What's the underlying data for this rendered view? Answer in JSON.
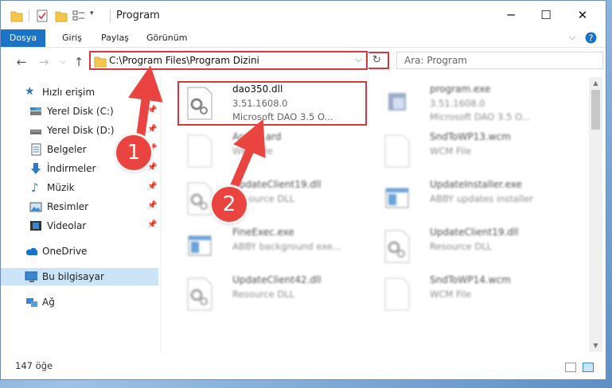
{
  "window": {
    "title": "Program",
    "controls": {
      "minimize": "─",
      "maximize": "☐",
      "close": "✕"
    }
  },
  "ribbon": {
    "tabs": [
      "Dosya",
      "Giriş",
      "Paylaş",
      "Görünüm"
    ],
    "accent": "#1a73c7"
  },
  "nav": {
    "address": "C:\\Program Files\\Program Dizini",
    "search_placeholder": "Ara: Program",
    "back": "←",
    "forward": "→",
    "up": "↑",
    "dropdown": "⌵",
    "refresh": "↻"
  },
  "sidebar": {
    "quick_access": "Hızlı erişim",
    "items": [
      {
        "label": "Yerel Disk (C:)",
        "icon": "drive-icon",
        "pinned": true
      },
      {
        "label": "Yerel Disk (D:)",
        "icon": "drive-icon",
        "pinned": true
      },
      {
        "label": "Belgeler",
        "icon": "documents-icon",
        "pinned": true
      },
      {
        "label": "İndirmeler",
        "icon": "downloads-icon",
        "pinned": true
      },
      {
        "label": "Müzik",
        "icon": "music-icon",
        "pinned": true
      },
      {
        "label": "Resimler",
        "icon": "pictures-icon",
        "pinned": true
      },
      {
        "label": "Videolar",
        "icon": "videos-icon",
        "pinned": true
      }
    ],
    "onedrive": "OneDrive",
    "this_pc": "Bu bilgisayar",
    "network": "Ağ"
  },
  "files": [
    {
      "name": "dao350.dll",
      "line2": "3.51.1608.0",
      "line3": "Microsoft DAO 3.5 O...",
      "icon": "dll-gear-icon",
      "highlighted": true
    },
    {
      "name": "program.exe",
      "line2": "3.51.1608.0",
      "line3": "Microsoft DAO 3.5 O...",
      "icon": "exe-icon"
    },
    {
      "name": "Arabic.ard",
      "line2": "WRD File",
      "line3": "",
      "icon": "file-icon"
    },
    {
      "name": "SndToWP13.wcm",
      "line2": "WCM File",
      "line3": "",
      "icon": "file-icon"
    },
    {
      "name": "UpdateClient19.dll",
      "line2": "Resource DLL",
      "line3": "",
      "icon": "dll-gear-icon"
    },
    {
      "name": "UpdateInstaller.exe",
      "line2": "ABBY updates installer",
      "line3": "",
      "icon": "window-icon"
    },
    {
      "name": "FineExec.exe",
      "line2": "ABBY background exe...",
      "line3": "",
      "icon": "window-icon"
    },
    {
      "name": "UpdateClient19.dll",
      "line2": "Resource DLL",
      "line3": "",
      "icon": "dll-gear-icon"
    },
    {
      "name": "UpdateClient42.dll",
      "line2": "Resource DLL",
      "line3": "",
      "icon": "dll-gear-icon"
    },
    {
      "name": "SndToWP14.wcm",
      "line2": "WCM File",
      "line3": "",
      "icon": "file-icon"
    }
  ],
  "status": {
    "count": "147 öğe"
  },
  "annotations": {
    "badge1": "1",
    "badge2": "2",
    "color": "#e9443f"
  }
}
